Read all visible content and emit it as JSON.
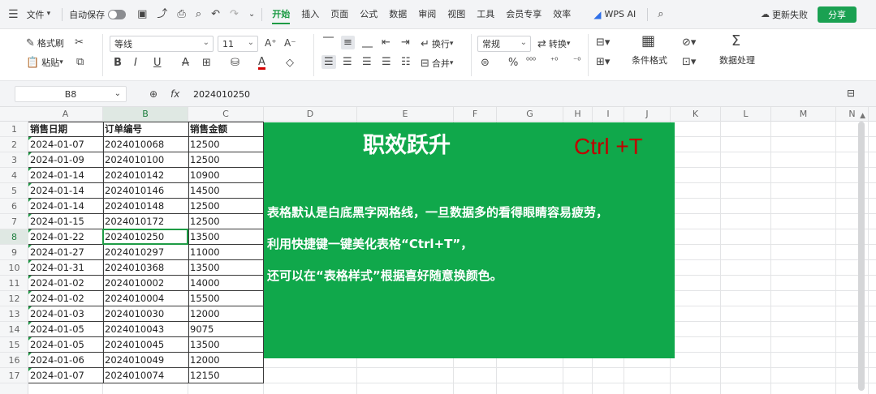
{
  "menu": {
    "file_label": "文件",
    "autosave_label": "自动保存",
    "tabs": [
      "开始",
      "插入",
      "页面",
      "公式",
      "数据",
      "审阅",
      "视图",
      "工具",
      "会员专享",
      "效率"
    ],
    "wps_ai_label": "WPS AI",
    "recent_label": "更新失败",
    "share_label": "分享"
  },
  "ribbon": {
    "format_painter": "格式刷",
    "paste": "粘贴",
    "font_name": "等线",
    "font_size": "11",
    "number_format": "常规",
    "wrap_label": "换行",
    "merge_label": "合并",
    "convert_label": "转换",
    "cond_format_label": "条件格式",
    "data_process_label": "数据处理"
  },
  "formula_bar": {
    "cell_ref": "B8",
    "fx_label": "fx",
    "value": "2024010250"
  },
  "columns": [
    "A",
    "B",
    "C",
    "D",
    "E",
    "F",
    "G",
    "H",
    "I",
    "J",
    "K",
    "L",
    "M",
    "N"
  ],
  "selected_column": "B",
  "selected_row": 8,
  "rows": [
    1,
    2,
    3,
    4,
    5,
    6,
    7,
    8,
    9,
    10,
    11,
    12,
    13,
    14,
    15,
    16,
    17
  ],
  "table": {
    "headers": [
      "销售日期",
      "订单编号",
      "销售金额"
    ],
    "data": [
      [
        "2024-01-07",
        "2024010068",
        "12500"
      ],
      [
        "2024-01-09",
        "2024010100",
        "12500"
      ],
      [
        "2024-01-14",
        "2024010142",
        "10900"
      ],
      [
        "2024-01-14",
        "2024010146",
        "14500"
      ],
      [
        "2024-01-14",
        "2024010148",
        "12500"
      ],
      [
        "2024-01-15",
        "2024010172",
        "12500"
      ],
      [
        "2024-01-22",
        "2024010250",
        "13500"
      ],
      [
        "2024-01-27",
        "2024010297",
        "11000"
      ],
      [
        "2024-01-31",
        "2024010368",
        "13500"
      ],
      [
        "2024-01-02",
        "2024010002",
        "14000"
      ],
      [
        "2024-01-02",
        "2024010004",
        "15500"
      ],
      [
        "2024-01-03",
        "2024010030",
        "12000"
      ],
      [
        "2024-01-05",
        "2024010043",
        "9075"
      ],
      [
        "2024-01-05",
        "2024010045",
        "13500"
      ],
      [
        "2024-01-06",
        "2024010049",
        "12000"
      ],
      [
        "2024-01-07",
        "2024010074",
        "12150"
      ]
    ]
  },
  "overlay": {
    "title": "职效跃升",
    "shortcut": "Ctrl +T",
    "lines": [
      "表格默认是白底黑字网格线，一旦数据多的看得眼睛容易疲劳，",
      "利用快捷键一键美化表格“Ctrl+T”，",
      "还可以在“表格样式”根据喜好随意换颜色。"
    ],
    "bg_color": "#10a84b",
    "shortcut_color": "#c00000"
  },
  "accent_color": "#1e9b45"
}
